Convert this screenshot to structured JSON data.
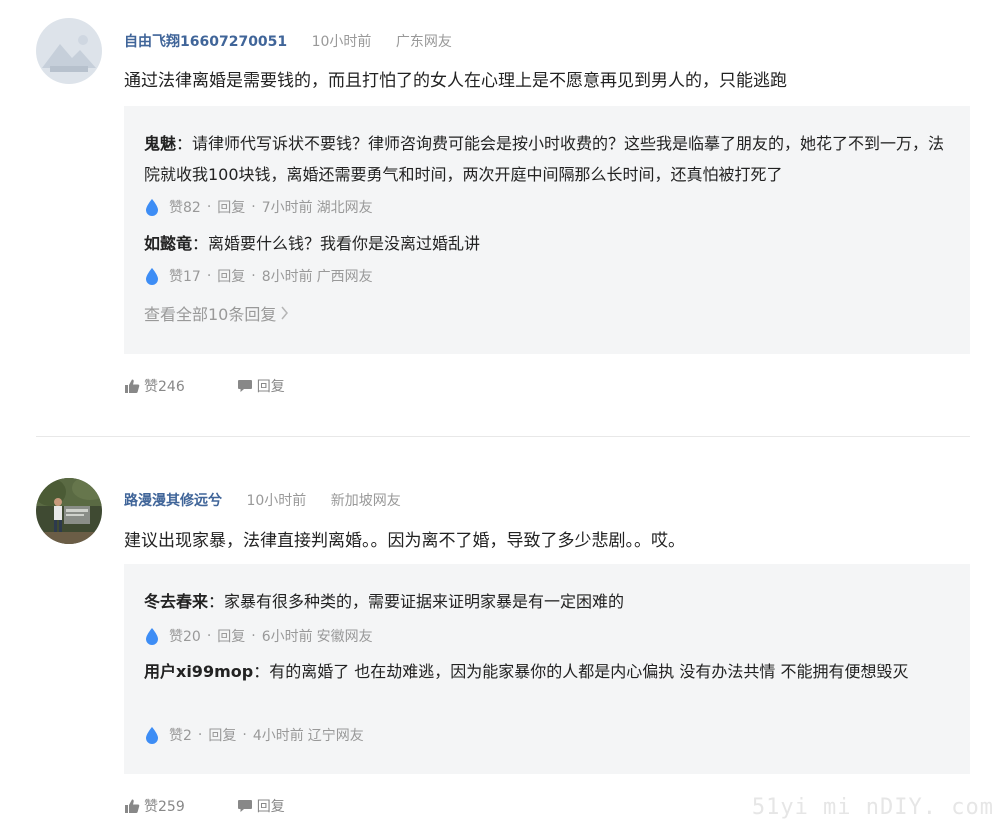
{
  "comments": [
    {
      "username": "自由飞翔16607270051",
      "time": "10小时前",
      "location": "广东网友",
      "text": "通过法律离婚是需要钱的，而且打怕了的女人在心理上是不愿意再见到男人的，只能逃跑",
      "replies": [
        {
          "name": "鬼魅",
          "text": "：请律师代写诉状不要钱？律师咨询费可能会是按小时收费的？这些我是临摹了朋友的，她花了不到一万，法院就收我100块钱，离婚还需要勇气和时间，两次开庭中间隔那么长时间，还真怕被打死了",
          "likes": "赞82",
          "reply_label": "回复",
          "time": "7小时前",
          "location": "湖北网友"
        },
        {
          "name": "如懿竜",
          "text": "：离婚要什么钱？我看你是没离过婚乱讲",
          "likes": "赞17",
          "reply_label": "回复",
          "time": "8小时前",
          "location": "广西网友"
        }
      ],
      "view_all": "查看全部10条回复",
      "like_label": "赞246",
      "reply_label": "回复"
    },
    {
      "username": "路漫漫其修远兮",
      "time": "10小时前",
      "location": "新加坡网友",
      "text": "建议出现家暴，法律直接判离婚。。因为离不了婚，导致了多少悲剧。。哎。",
      "replies": [
        {
          "name": "冬去春来",
          "text": "：家暴有很多种类的，需要证据来证明家暴是有一定困难的",
          "likes": "赞20",
          "reply_label": "回复",
          "time": "6小时前",
          "location": "安徽网友"
        },
        {
          "name": "用户xi99mop",
          "text": "：有的离婚了 也在劫难逃，因为能家暴你的人都是内心偏执 没有办法共情 不能拥有便想毁灭",
          "likes": "赞2",
          "reply_label": "回复",
          "time": "4小时前",
          "location": "辽宁网友"
        }
      ],
      "like_label": "赞259",
      "reply_label": "回复"
    }
  ],
  "separator": "·",
  "watermark": "51yi mi nDIY. com",
  "colors": {
    "username": "#406599",
    "gray": "#999999",
    "reply_bg": "#f4f5f6",
    "drop_icon": "#3d8df5"
  }
}
